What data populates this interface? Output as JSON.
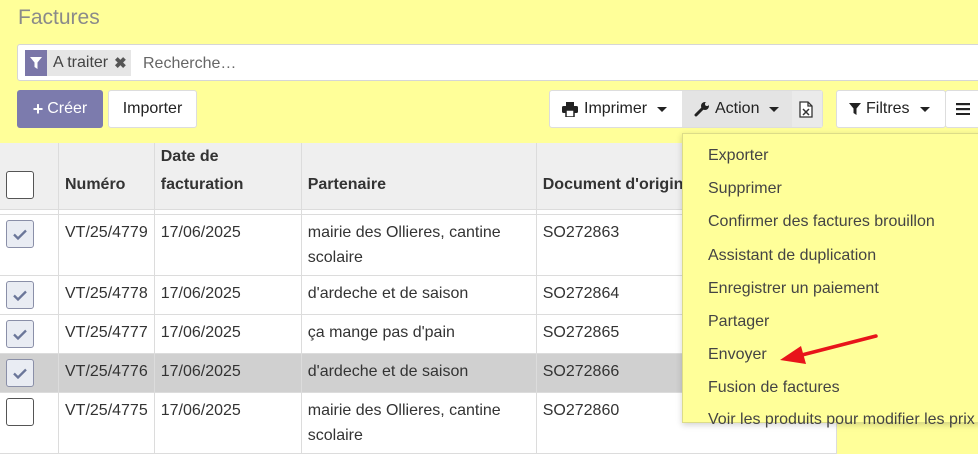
{
  "page": {
    "title": "Factures"
  },
  "search": {
    "facet_label": "A traiter",
    "facet_icon": "filter-icon",
    "placeholder": "Recherche…"
  },
  "toolbar": {
    "create_label": "Créer",
    "import_label": "Importer",
    "print_label": "Imprimer",
    "action_label": "Action",
    "filters_label": "Filtres",
    "export_icon": "excel-file-icon",
    "group_icon": "list-icon"
  },
  "table": {
    "headers": {
      "number": "Numéro",
      "date_line1": "Date de",
      "date_line2": "facturation",
      "partner": "Partenaire",
      "origin": "Document d'origine"
    },
    "rows": [
      {
        "checked": true,
        "number": "VT/25/4779",
        "date": "17/06/2025",
        "partner_line1": "mairie des Ollieres, cantine",
        "partner_line2": "scolaire",
        "origin": "SO272863"
      },
      {
        "checked": true,
        "number": "VT/25/4778",
        "date": "17/06/2025",
        "partner_line1": "d'ardeche et de saison",
        "partner_line2": "",
        "origin": "SO272864"
      },
      {
        "checked": true,
        "number": "VT/25/4777",
        "date": "17/06/2025",
        "partner_line1": "ça mange pas d'pain",
        "partner_line2": "",
        "origin": "SO272865"
      },
      {
        "checked": true,
        "number": "VT/25/4776",
        "date": "17/06/2025",
        "partner_line1": "d'ardeche et de saison",
        "partner_line2": "",
        "origin": "SO272866",
        "highlighted": true
      },
      {
        "checked": false,
        "number": "VT/25/4775",
        "date": "17/06/2025",
        "partner_line1": "mairie des Ollieres, cantine",
        "partner_line2": "scolaire",
        "origin": "SO272860"
      }
    ]
  },
  "action_menu": {
    "items": [
      "Exporter",
      "Supprimer",
      "Confirmer des factures brouillon",
      "Assistant de duplication",
      "Enregistrer un paiement",
      "Partager",
      "Envoyer",
      "Fusion de factures",
      "Voir les produits pour modifier les prix"
    ],
    "annotation_color": "#e8141a"
  },
  "colors": {
    "background": "#ffff99",
    "primary": "#7c7bad",
    "arrow": "#e8141a"
  }
}
